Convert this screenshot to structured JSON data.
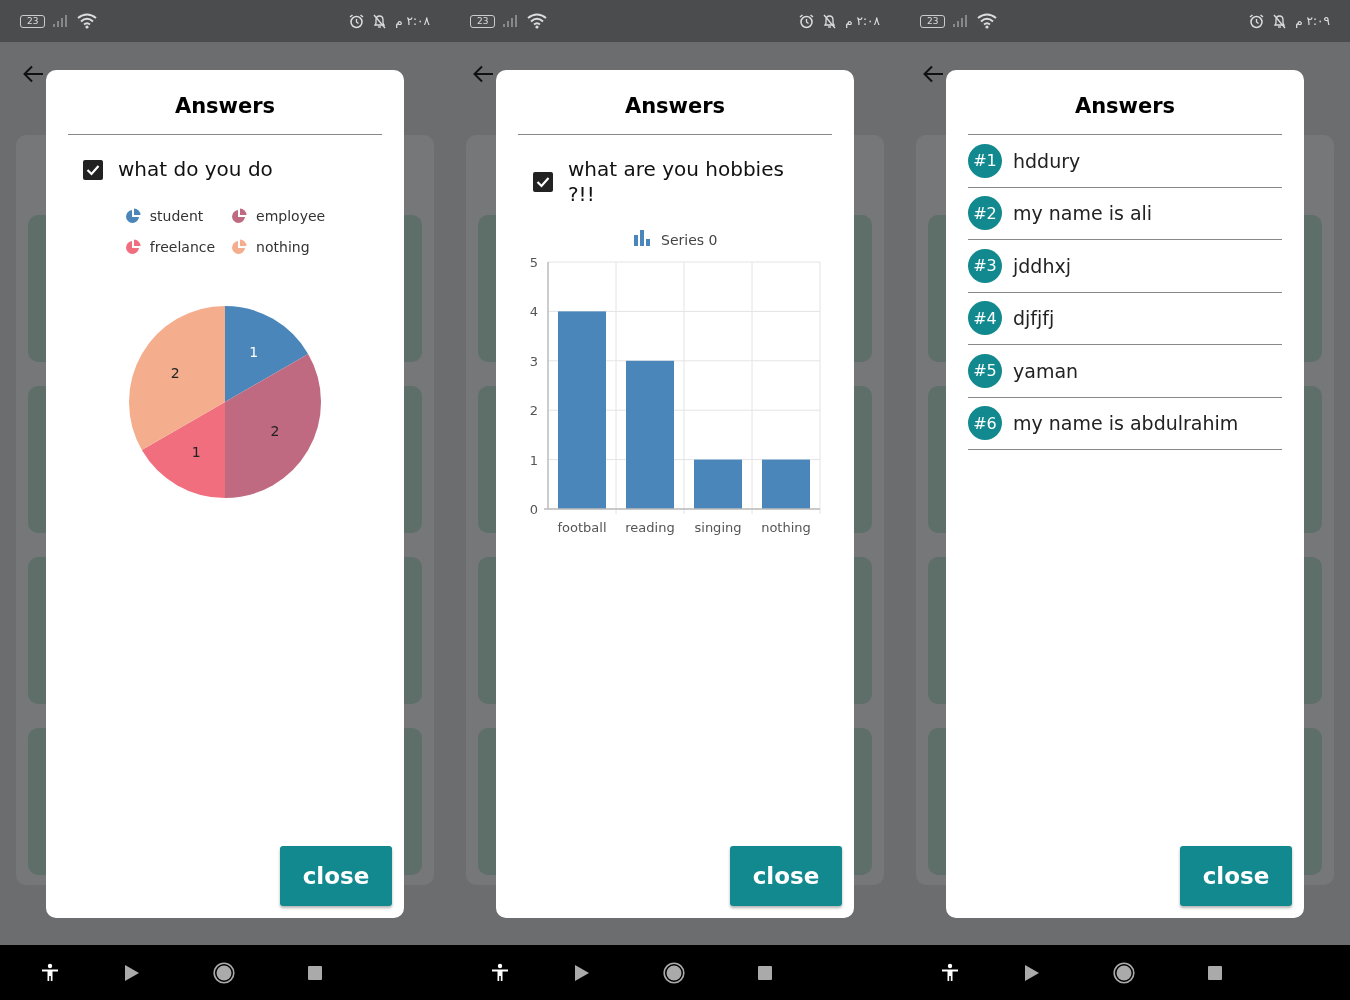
{
  "panels": [
    {
      "status_bar": {
        "battery": "23",
        "time": "٢:٠٨ م"
      },
      "dialog": {
        "title": "Answers",
        "kind": "chart",
        "question": {
          "text": "what do you do",
          "checked": true
        },
        "legend": [
          {
            "color": "#4a86b9"
          },
          {
            "color": "#c06a82"
          },
          {
            "color": "#f06e7e"
          },
          {
            "color": "#f4ae8e"
          }
        ],
        "chart_data": {
          "type": "pie",
          "categories": [
            "student",
            "employee",
            "freelance",
            "nothing"
          ],
          "values": [
            1,
            2,
            1,
            2
          ],
          "data_labels": true
        },
        "close_button": "close"
      }
    },
    {
      "status_bar": {
        "battery": "23",
        "time": "٢:٠٨ م"
      },
      "dialog": {
        "title": "Answers",
        "kind": "chart",
        "question": {
          "text": "what are you hobbies ?!!",
          "checked": true
        },
        "chart_data": {
          "type": "bar",
          "categories": [
            "football",
            "reading",
            "singing",
            "nothing"
          ],
          "series": [
            {
              "name": "Series 0",
              "color": "#4a86b9",
              "values": [
                4,
                3,
                1,
                1
              ]
            }
          ],
          "ylim": [
            0,
            5
          ],
          "yticks": [
            0,
            1,
            2,
            3,
            4,
            5
          ],
          "grid": true
        },
        "close_button": "close"
      }
    },
    {
      "status_bar": {
        "battery": "23",
        "time": "٢:٠٩ م"
      },
      "dialog": {
        "title": "Answers",
        "kind": "list",
        "answers": [
          {
            "badge": "#1",
            "text": "hddury"
          },
          {
            "badge": "#2",
            "text": "my name is ali"
          },
          {
            "badge": "#3",
            "text": "jddhxj"
          },
          {
            "badge": "#4",
            "text": "djfjfj"
          },
          {
            "badge": "#5",
            "text": "yaman"
          },
          {
            "badge": "#6",
            "text": "my name is abdulrahim"
          }
        ],
        "close_button": "close"
      }
    }
  ]
}
